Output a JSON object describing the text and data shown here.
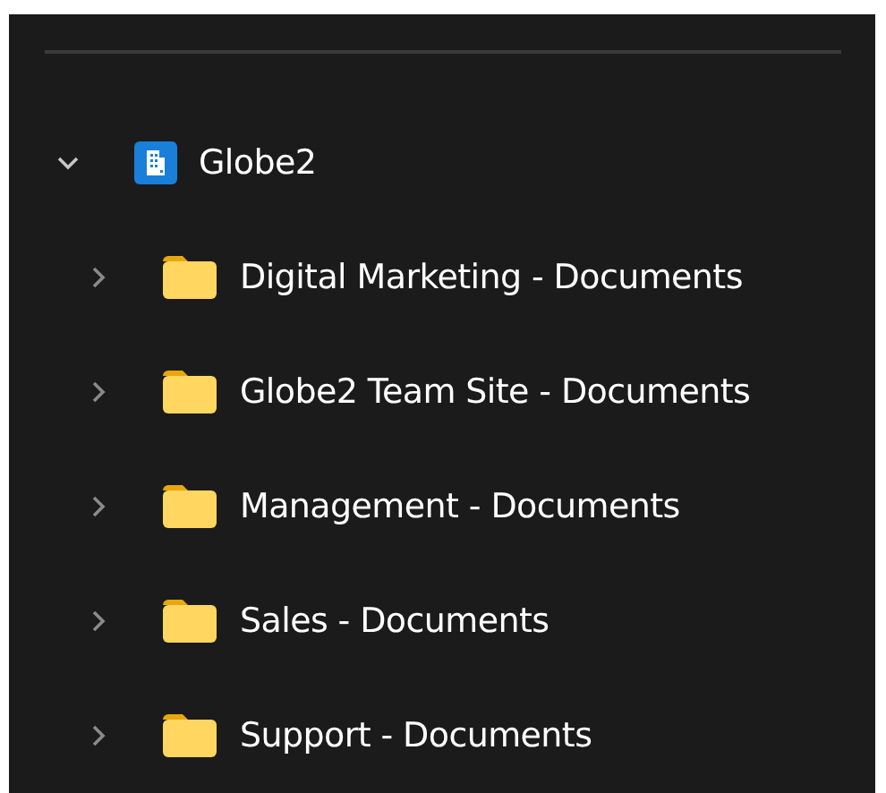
{
  "tree": [
    {
      "label": "Globe2",
      "kind": "site",
      "expanded": true,
      "children": [
        {
          "label": "Digital Marketing - Documents",
          "kind": "folder",
          "expanded": false
        },
        {
          "label": "Globe2 Team Site - Documents",
          "kind": "folder",
          "expanded": false
        },
        {
          "label": "Management - Documents",
          "kind": "folder",
          "expanded": false
        },
        {
          "label": "Sales - Documents",
          "kind": "folder",
          "expanded": false
        },
        {
          "label": "Support - Documents",
          "kind": "folder",
          "expanded": false
        }
      ]
    }
  ]
}
